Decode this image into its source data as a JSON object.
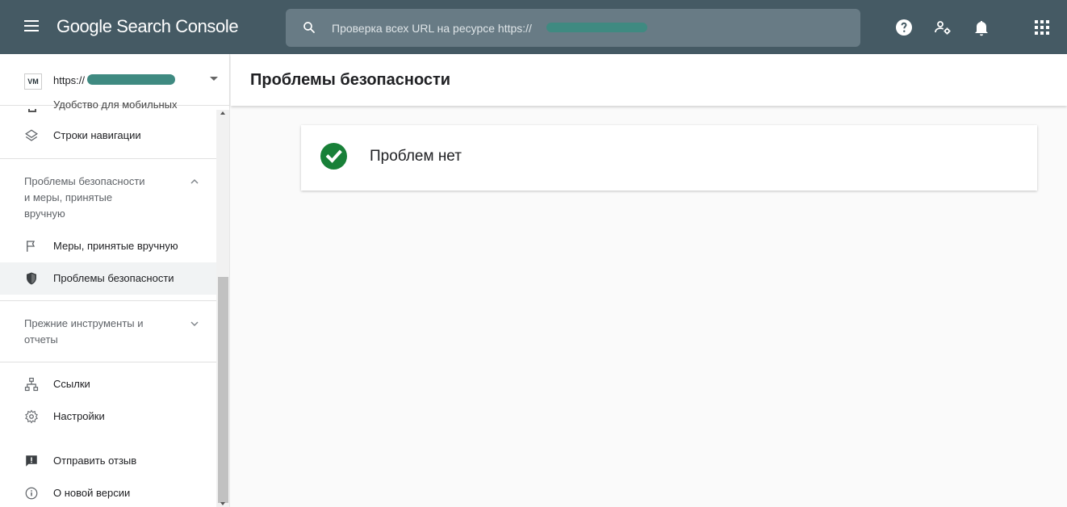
{
  "app": {
    "brand": "Google Search Console"
  },
  "header": {
    "search_placeholder": "Проверка всех URL на ресурсе https://"
  },
  "property": {
    "logo_text": "VM",
    "url_prefix": "https://"
  },
  "sidebar": {
    "cut_item": "Удобство для мобильных",
    "items": [
      {
        "label": "Строки навигации",
        "icon": "layers-icon"
      },
      {
        "label": "Меры, принятые вручную",
        "icon": "flag-icon"
      },
      {
        "label": "Проблемы безопасности",
        "icon": "shield-icon",
        "active": true
      },
      {
        "label": "Ссылки",
        "icon": "sitemap-icon"
      },
      {
        "label": "Настройки",
        "icon": "gear-icon"
      },
      {
        "label": "Отправить отзыв",
        "icon": "feedback-icon"
      },
      {
        "label": "О новой версии",
        "icon": "info-icon"
      }
    ],
    "sections": [
      {
        "title": "Проблемы безопасности и меры, принятые вручную",
        "title_lines": [
          "Проблемы безопасности",
          "и меры, принятые",
          "вручную"
        ],
        "expanded": true
      },
      {
        "title": "Прежние инструменты и отчеты",
        "title_lines": [
          "Прежние инструменты и",
          "отчеты"
        ],
        "expanded": false
      }
    ]
  },
  "main": {
    "title": "Проблемы безопасности",
    "status": "Проблем нет"
  },
  "colors": {
    "topbar": "#455a64",
    "accent_green": "#188038",
    "active_bg": "#f1f3f4"
  }
}
